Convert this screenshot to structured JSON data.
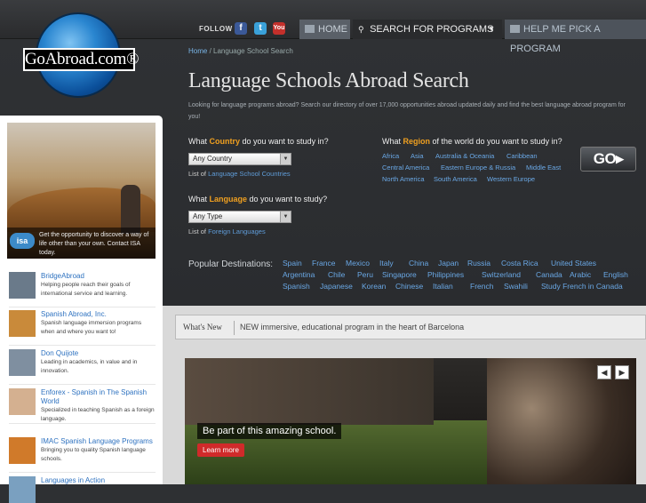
{
  "site": {
    "logo_text": "GoAbroad.com®"
  },
  "topnav": {
    "follow": "FOLLOW",
    "social": [
      {
        "name": "facebook-icon",
        "glyph": "f"
      },
      {
        "name": "twitter-icon",
        "glyph": "t"
      },
      {
        "name": "youtube-icon",
        "glyph": "You"
      }
    ],
    "home": "HOME",
    "search": "SEARCH FOR PROGRAMS",
    "help": "HELP ME PICK A PROGRAM"
  },
  "breadcrumb": {
    "home": "Home",
    "sep": " / ",
    "current": "Language School Search"
  },
  "page": {
    "title": "Language Schools Abroad Search",
    "intro": "Looking for language programs abroad? Search our directory of over 17,000 opportunities abroad updated daily and find the best language abroad program for you!"
  },
  "country": {
    "q_pre": "What ",
    "q_hl": "Country",
    "q_post": " do you want to study in?",
    "select": "Any Country",
    "list_pre": "List of ",
    "list_link": "Language School Countries"
  },
  "language": {
    "q_pre": "What ",
    "q_hl": "Language",
    "q_post": " do you want to study?",
    "select": "Any Type",
    "list_pre": "List of ",
    "list_link": "Foreign Languages"
  },
  "region": {
    "q_pre": "What ",
    "q_hl": "Region",
    "q_post": " of the world do you want to study in?",
    "rows": [
      [
        "Africa",
        "Asia",
        "Australia & Oceania",
        "Caribbean"
      ],
      [
        "Central America",
        "Eastern Europe & Russia",
        "Middle East"
      ],
      [
        "North America",
        "South America",
        "Western Europe"
      ]
    ]
  },
  "go": "GO▸",
  "popular": {
    "label": "Popular Destinations:",
    "rows": [
      [
        "Spain",
        "France",
        "Mexico",
        "Italy",
        "China",
        "Japan",
        "Russia",
        "Costa Rica",
        "United States"
      ],
      [
        "Argentina",
        "Chile",
        "Peru",
        "Singapore",
        "Philippines",
        "Switzerland",
        "Canada",
        "Arabic",
        "English"
      ],
      [
        "Spanish",
        "Japanese",
        "Korean",
        "Chinese",
        "Italian",
        "French",
        "Swahili",
        "Study French in Canada"
      ]
    ]
  },
  "promo": {
    "logo": "isa",
    "text": "Get the opportunity to discover a way of life other than your own. Contact ISA today."
  },
  "sidebar": [
    {
      "title": "BridgeAbroad",
      "desc": "Helping people reach their goals of international service and learning."
    },
    {
      "title": "Spanish Abroad, Inc.",
      "desc": "Spanish language immersion programs when and where you want to!"
    },
    {
      "title": "Don Quijote",
      "desc": "Leading in academics, in value and in innovation."
    },
    {
      "title": "Enforex - Spanish in The Spanish World",
      "desc": "Specialized in teaching Spanish as a foreign language."
    },
    {
      "title": "IMAC Spanish Language Programs",
      "desc": "Bringing you to quality Spanish language schools."
    },
    {
      "title": "Languages in Action",
      "desc": ""
    }
  ],
  "whatsnew": {
    "label": "What's New",
    "text": "NEW immersive, educational program in the heart of Barcelona"
  },
  "slider": {
    "caption": "Be part of this amazing school.",
    "button": "Learn more",
    "prev": "◀",
    "next": "▶"
  }
}
